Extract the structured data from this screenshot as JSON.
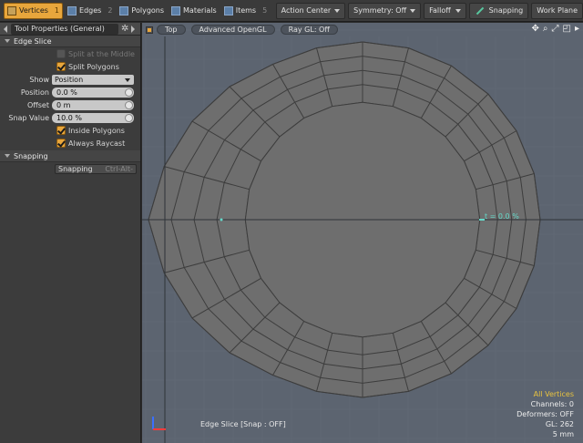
{
  "toolbar": {
    "modes": [
      {
        "label": "Vertices",
        "num": "1",
        "icon": "vertices-icon",
        "active": true
      },
      {
        "label": "Edges",
        "num": "2",
        "icon": "edges-icon",
        "active": false
      },
      {
        "label": "Polygons",
        "num": "",
        "icon": "polygons-icon",
        "active": false
      },
      {
        "label": "Materials",
        "num": "",
        "icon": "materials-icon",
        "active": false
      },
      {
        "label": "Items",
        "num": "5",
        "icon": "items-icon",
        "active": false
      }
    ],
    "action_center": "Action Center",
    "symmetry": "Symmetry: Off",
    "falloff": "Falloff",
    "snapping": "Snapping",
    "work_plane": "Work Plane"
  },
  "panel": {
    "tab_title": "Tool Properties (General)",
    "edge_slice": {
      "title": "Edge Slice",
      "split_middle": "Split at the Middle",
      "split_polygons": "Split Polygons",
      "show_label": "Show",
      "show_value": "Position",
      "position_label": "Position",
      "position_value": "0.0 %",
      "offset_label": "Offset",
      "offset_value": "0 m",
      "snap_label": "Snap Value",
      "snap_value": "10.0 %",
      "inside_polygons": "Inside Polygons",
      "always_raycast": "Always Raycast"
    },
    "snapping": {
      "title": "Snapping",
      "button": "Snapping",
      "shortcut": "Ctrl-Alt-"
    }
  },
  "viewport": {
    "view": "Top",
    "renderer": "Advanced OpenGL",
    "raygl": "Ray GL: Off",
    "t_label": "t = 0.0 %",
    "status": "Edge Slice  [Snap : OFF]",
    "readout": {
      "selection": "All Vertices",
      "channels": "Channels: 0",
      "deformers": "Deformers: OFF",
      "gl": "GL: 262",
      "scale": "5 mm"
    },
    "colors": {
      "background": "#5c6470",
      "mesh": "#6e6e6e",
      "wire": "#3d3d3d",
      "accent": "#e8a63c",
      "readout_title": "#e8c340",
      "edge_marker": "#64d9c9"
    }
  }
}
